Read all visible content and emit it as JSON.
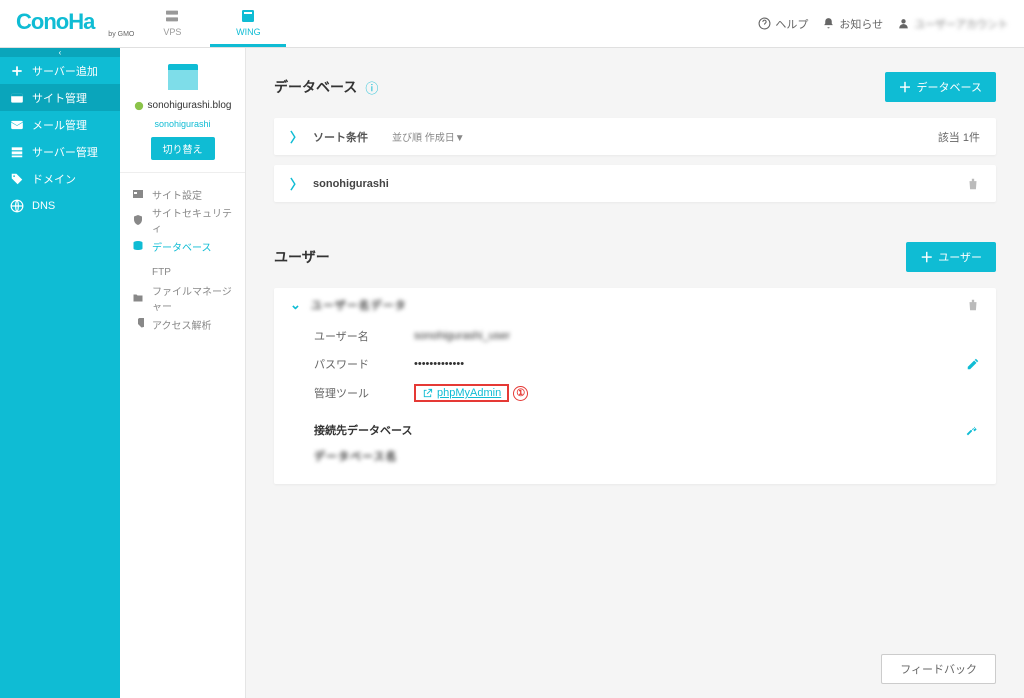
{
  "header": {
    "logo": "ConoHa",
    "logo_sub": "by GMO",
    "tabs": [
      {
        "label": "VPS",
        "active": false
      },
      {
        "label": "WING",
        "active": true
      }
    ],
    "help": "ヘルプ",
    "notice": "お知らせ",
    "user": "ユーザーアカウント"
  },
  "sidebar": {
    "items": [
      {
        "label": "サーバー追加",
        "icon": "plus"
      },
      {
        "label": "サイト管理",
        "icon": "window",
        "active": true
      },
      {
        "label": "メール管理",
        "icon": "mail"
      },
      {
        "label": "サーバー管理",
        "icon": "server"
      },
      {
        "label": "ドメイン",
        "icon": "tag"
      },
      {
        "label": "DNS",
        "icon": "globe"
      }
    ]
  },
  "site": {
    "domain": "sonohigurashi.blog",
    "sub": "sonohigurashi",
    "switch_btn": "切り替え",
    "nav": [
      {
        "label": "サイト設定",
        "icon": "site"
      },
      {
        "label": "サイトセキュリティ",
        "icon": "shield"
      },
      {
        "label": "データベース",
        "icon": "database",
        "active": true
      },
      {
        "label": "FTP",
        "icon": "ftp"
      },
      {
        "label": "ファイルマネージャー",
        "icon": "folder"
      },
      {
        "label": "アクセス解析",
        "icon": "pie"
      }
    ]
  },
  "database": {
    "title": "データベース",
    "add_btn": "データベース",
    "sort_label": "ソート条件",
    "sort_by": "並び順 作成日▼",
    "count": "該当 1件",
    "items": [
      {
        "name": "sonohigurashi"
      }
    ]
  },
  "users": {
    "title": "ユーザー",
    "add_btn": "ユーザー",
    "expanded_user": "ユーザー名データ",
    "fields": {
      "username_label": "ユーザー名",
      "username_value": "sonohigurashi_user",
      "password_label": "パスワード",
      "password_value": "•••••••••••••",
      "tool_label": "管理ツール",
      "tool_link": "phpMyAdmin"
    },
    "connected_db_label": "接続先データベース",
    "connected_db_value": "データベース名"
  },
  "annotation": {
    "num": "①"
  },
  "feedback": "フィードバック"
}
